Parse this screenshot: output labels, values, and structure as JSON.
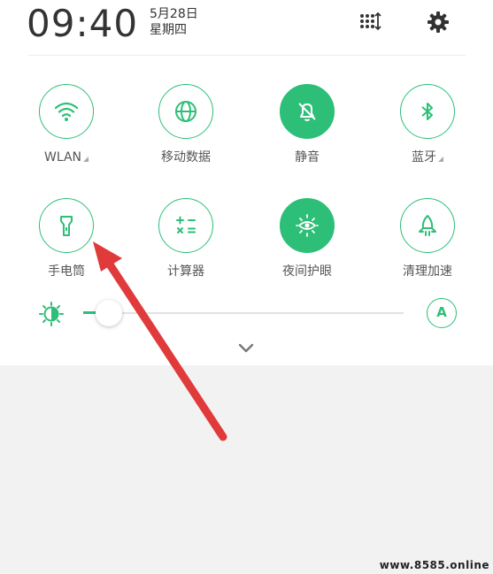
{
  "status": {
    "time": "09:40",
    "date": "5月28日",
    "weekday": "星期四"
  },
  "header": {
    "edit_icon": "grid-sort-icon",
    "settings_icon": "gear-icon"
  },
  "tiles": [
    {
      "label": "WLAN",
      "icon": "wifi-icon",
      "active": false,
      "expandable": true
    },
    {
      "label": "移动数据",
      "icon": "globe-icon",
      "active": false,
      "expandable": false
    },
    {
      "label": "静音",
      "icon": "bell-off-icon",
      "active": true,
      "expandable": false
    },
    {
      "label": "蓝牙",
      "icon": "bluetooth-icon",
      "active": false,
      "expandable": true
    },
    {
      "label": "手电筒",
      "icon": "flashlight-icon",
      "active": false,
      "expandable": false
    },
    {
      "label": "计算器",
      "icon": "calculator-icon",
      "active": false,
      "expandable": false
    },
    {
      "label": "夜间护眼",
      "icon": "eye-sun-icon",
      "active": true,
      "expandable": false
    },
    {
      "label": "清理加速",
      "icon": "rocket-icon",
      "active": false,
      "expandable": false
    }
  ],
  "brightness": {
    "level": 0.04,
    "auto_label": "A"
  },
  "colors": {
    "accent": "#2dbf77",
    "arrow": "#e03a3a",
    "panel_bg": "#ffffff",
    "page_bg": "#f2f2f2"
  },
  "watermark": "www.8585.online"
}
